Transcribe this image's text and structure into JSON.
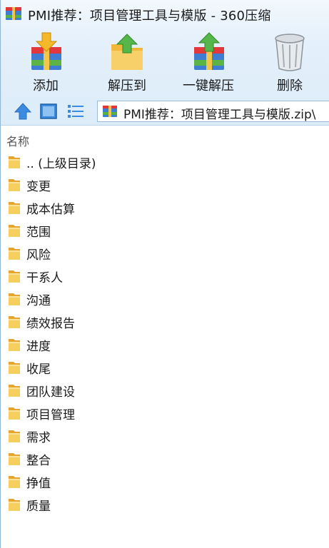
{
  "window": {
    "title": "PMI推荐：项目管理工具与模版 - 360压缩"
  },
  "toolbar": {
    "add_label": "添加",
    "extract_to_label": "解压到",
    "one_click_extract_label": "一键解压",
    "delete_label": "删除"
  },
  "address": {
    "path": "PMI推荐：项目管理工具与模版.zip\\"
  },
  "list": {
    "column_name": "名称",
    "items": [
      {
        "name": ".. (上级目录)"
      },
      {
        "name": "变更"
      },
      {
        "name": "成本估算"
      },
      {
        "name": "范围"
      },
      {
        "name": "风险"
      },
      {
        "name": "干系人"
      },
      {
        "name": "沟通"
      },
      {
        "name": "绩效报告"
      },
      {
        "name": "进度"
      },
      {
        "name": "收尾"
      },
      {
        "name": "团队建设"
      },
      {
        "name": "项目管理"
      },
      {
        "name": "需求"
      },
      {
        "name": "整合"
      },
      {
        "name": "挣值"
      },
      {
        "name": "质量"
      }
    ]
  },
  "colors": {
    "accent": "#3b8be0",
    "folder": "#f2c04b",
    "chrome_bg": "#e4f0fb",
    "border": "#9dbad6"
  }
}
